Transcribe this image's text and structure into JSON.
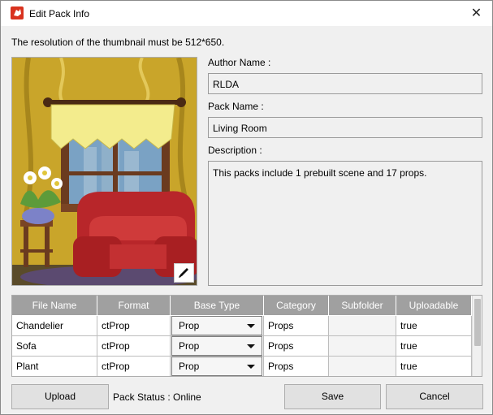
{
  "window": {
    "title": "Edit Pack Info",
    "close_glyph": "✕"
  },
  "hint": "The resolution of the thumbnail must be 512*650.",
  "thumbnail": {
    "icon": "pencil-icon"
  },
  "form": {
    "author_label": "Author Name :",
    "author_value": "RLDA",
    "pack_label": "Pack Name :",
    "pack_value": "Living Room",
    "desc_label": "Description :",
    "desc_value": "This packs include 1 prebuilt scene and 17 props."
  },
  "table": {
    "columns": [
      "File Name",
      "Format",
      "Base Type",
      "Category",
      "Subfolder",
      "Uploadable"
    ],
    "rows": [
      {
        "file": "Chandelier",
        "format": "ctProp",
        "base": "Prop",
        "category": "Props",
        "subfolder": "",
        "uploadable": "true"
      },
      {
        "file": "Sofa",
        "format": "ctProp",
        "base": "Prop",
        "category": "Props",
        "subfolder": "",
        "uploadable": "true"
      },
      {
        "file": "Plant",
        "format": "ctProp",
        "base": "Prop",
        "category": "Props",
        "subfolder": "",
        "uploadable": "true"
      }
    ]
  },
  "footer": {
    "upload_label": "Upload",
    "status_text": "Pack Status : Online",
    "save_label": "Save",
    "cancel_label": "Cancel"
  },
  "colors": {
    "header_bg": "#a0a0a0",
    "app_icon": "#d9331f"
  }
}
